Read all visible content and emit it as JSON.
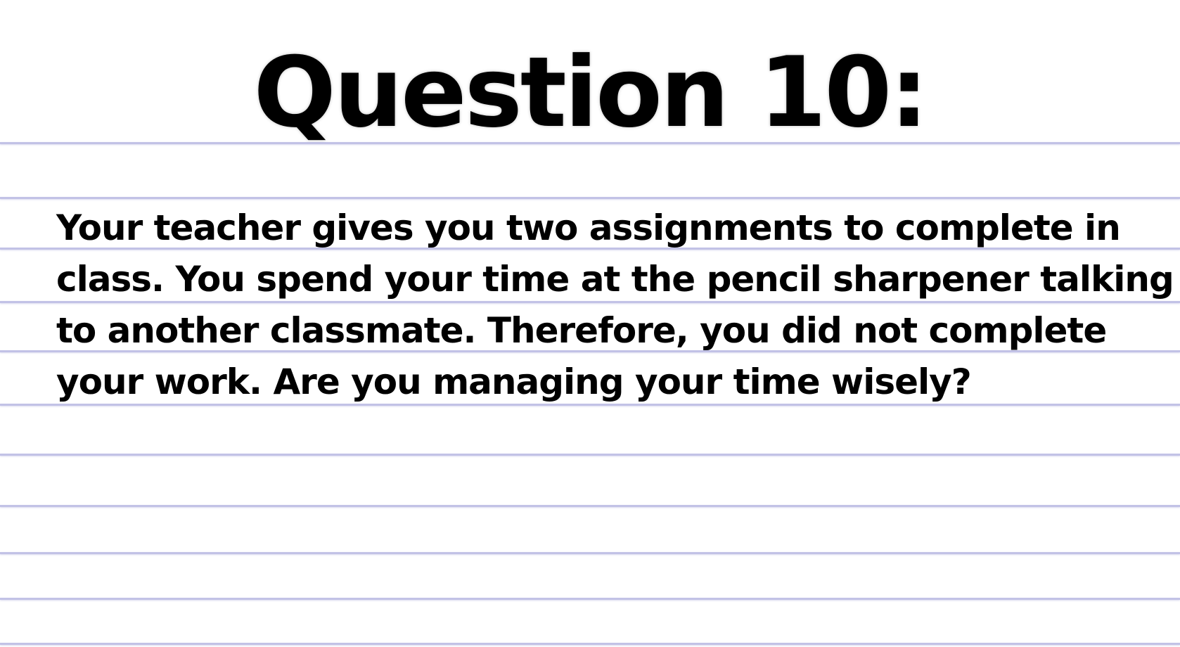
{
  "title": "Question 10:",
  "question_lines": [
    "Your teacher gives you two assignments to complete in",
    "class. You spend your time at the pencil sharpener talking",
    "to another classmate. Therefore, you did not complete",
    "your work. Are you managing your time wisely?"
  ],
  "colors": {
    "background": "#ffffff",
    "rule_line": "#c2c2e6",
    "text": "#000000"
  }
}
